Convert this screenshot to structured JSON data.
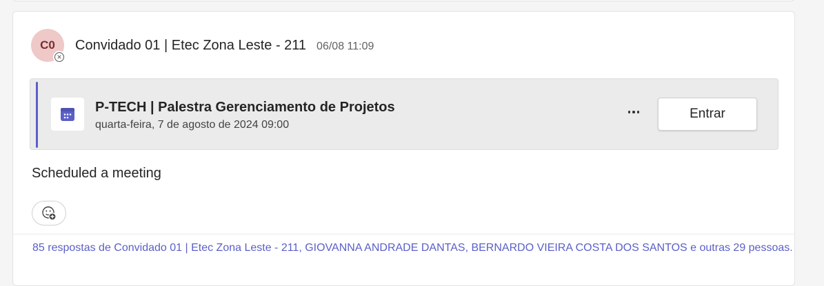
{
  "post": {
    "avatar_initials": "C0",
    "author": "Convidado 01 | Etec Zona Leste - 211",
    "timestamp": "06/08 11:09",
    "body": "Scheduled a meeting"
  },
  "meeting": {
    "icon": "calendar-icon",
    "title": "P-TECH | Palestra Gerenciamento de Projetos",
    "datetime": "quarta-feira, 7 de agosto de 2024 09:00",
    "join_label": "Entrar"
  },
  "replies_summary": "85 respostas de Convidado 01 | Etec Zona Leste - 211, GIOVANNA ANDRADE DANTAS, BERNARDO VIEIRA COSTA DOS SANTOS e outras 29 pessoas.",
  "colors": {
    "accent": "#5b5fc7",
    "avatar_bg": "#efc8c8",
    "card_bg": "#ebebeb"
  }
}
